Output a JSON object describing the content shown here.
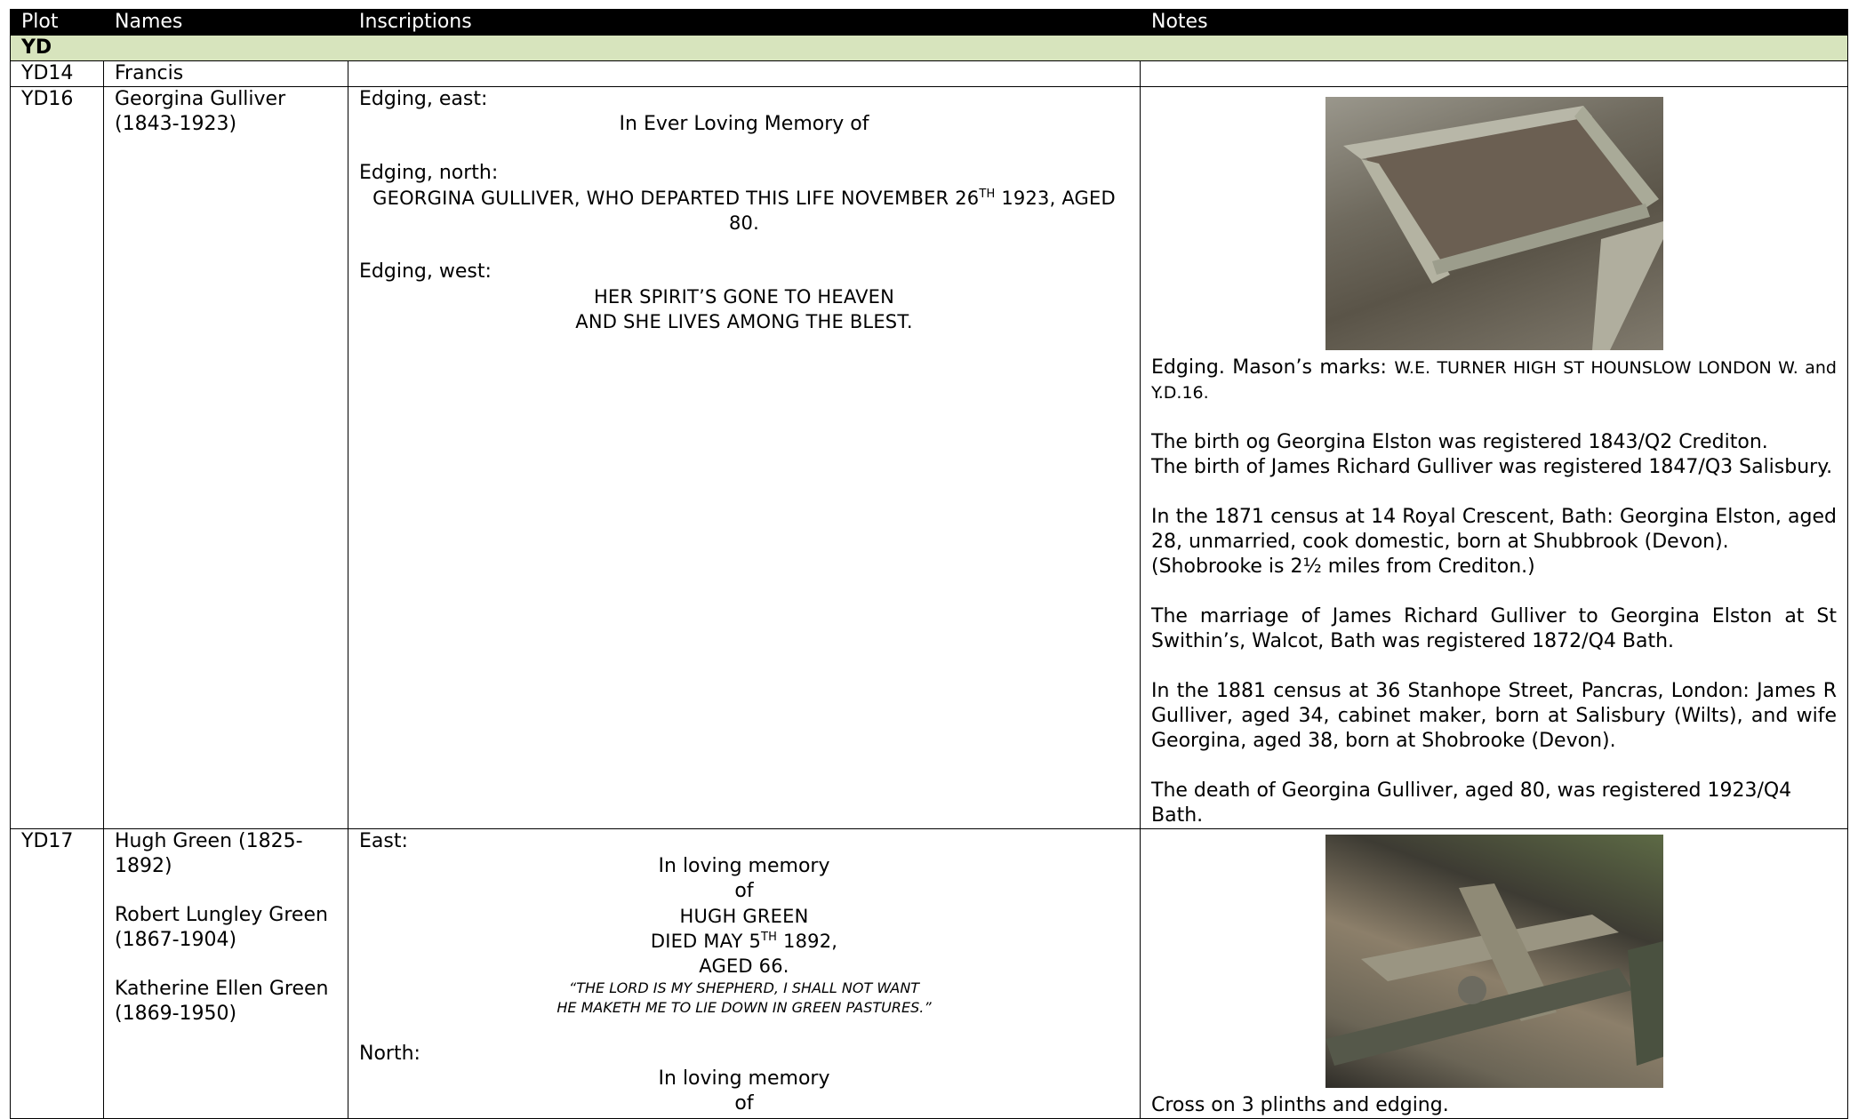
{
  "headers": {
    "plot": "Plot",
    "names": "Names",
    "inscriptions": "Inscriptions",
    "notes": "Notes"
  },
  "section": "YD",
  "rows": {
    "yd14": {
      "plot": "YD14",
      "name": "Francis"
    },
    "yd16": {
      "plot": "YD16",
      "name": "Georgina Gulliver",
      "years": "(1843-1923)",
      "east_label": "Edging, east:",
      "east_text": "In Ever Loving Memory of",
      "north_label": "Edging, north:",
      "north_text_a": "GEORGINA GULLIVER, WHO DEPARTED THIS LIFE NOVEMBER 26",
      "north_sup": "TH",
      "north_text_b": " 1923, AGED 80.",
      "west_label": "Edging, west:",
      "west_line1": "HER SPIRIT’S GONE TO HEAVEN",
      "west_line2": "AND SHE LIVES AMONG THE BLEST.",
      "photo_icon": "grave-edging-photo",
      "note_marks_a": "Edging. Mason’s marks: ",
      "note_marks_b": "W.E. TURNER HIGH ST HOUNSLOW LONDON W. and Y.D.16.",
      "note_birth1": "The birth og Georgina Elston was registered 1843/Q2 Crediton.",
      "note_birth2": "The birth of James Richard Gulliver was registered 1847/Q3 Salisbury.",
      "note_1871": "In the 1871 census at 14 Royal Crescent, Bath: Georgina Elston, aged 28, unmarried, cook domestic, born at Shubbrook (Devon).",
      "note_shobrooke": "(Shobrooke is 2½ miles from Crediton.)",
      "note_marriage": "The marriage of James Richard Gulliver to Georgina Elston at St Swithin’s, Walcot, Bath was registered 1872/Q4 Bath.",
      "note_1881": "In the 1881 census at 36 Stanhope Street, Pancras, London: James R Gulliver, aged 34, cabinet maker, born at Salisbury (Wilts), and wife Georgina, aged 38, born at Shobrooke (Devon).",
      "note_death": "The death of Georgina Gulliver, aged 80, was registered 1923/Q4 Bath."
    },
    "yd17": {
      "plot": "YD17",
      "name1": "Hugh Green (1825-1892)",
      "name2": "Robert Lungley Green (1867-1904)",
      "name3": "Katherine Ellen Green (1869-1950)",
      "east_label": "East:",
      "east_l1": "In loving memory",
      "east_l2": "of",
      "east_l3": "HUGH GREEN",
      "east_l4a": "DIED MAY 5",
      "east_l4sup": "TH",
      "east_l4b": " 1892,",
      "east_l5": "AGED 66.",
      "east_q1": "“THE LORD IS MY SHEPHERD, I SHALL NOT WANT",
      "east_q2": "HE MAKETH ME TO LIE DOWN IN GREEN PASTURES.”",
      "north_label": "North:",
      "north_l1": "In loving memory",
      "north_l2": "of",
      "photo_icon": "fallen-cross-photo",
      "note_cross": "Cross on 3 plinths and edging."
    }
  }
}
